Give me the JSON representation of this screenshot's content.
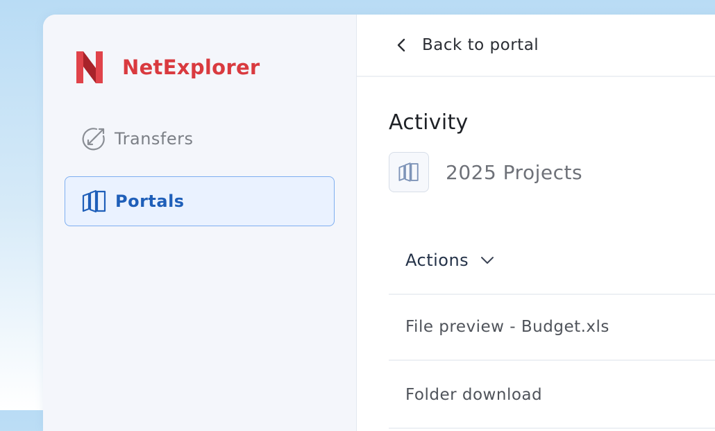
{
  "brand": {
    "name": "NetExplorer",
    "color": "#d93a3f"
  },
  "sidebar": {
    "items": [
      {
        "label": "Transfers",
        "icon": "transfers-icon",
        "active": false
      },
      {
        "label": "Portals",
        "icon": "portals-icon",
        "active": true
      }
    ],
    "active_color": "#1f5fb9"
  },
  "topbar": {
    "back_label": "Back to portal",
    "back_icon": "chevron-left-icon"
  },
  "main": {
    "title": "Activity",
    "portal": {
      "name": "2025 Projects",
      "icon": "portals-icon"
    },
    "actions": {
      "label": "Actions",
      "icon": "chevron-down-icon",
      "rows": [
        {
          "label": "File preview - Budget.xls"
        },
        {
          "label": "Folder download"
        }
      ]
    }
  }
}
